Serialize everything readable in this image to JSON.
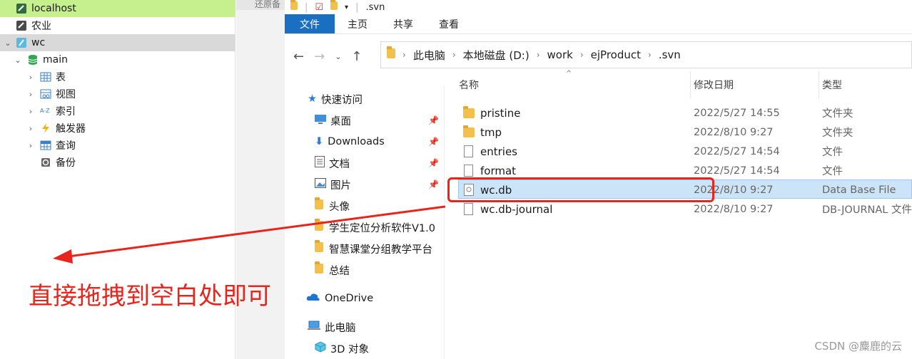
{
  "left_tree": {
    "items": [
      {
        "label": "localhost",
        "icon": "connection-icon"
      },
      {
        "label": "农业",
        "icon": "connection-icon"
      },
      {
        "label": "wc",
        "icon": "sqlite-connection-icon"
      },
      {
        "label": "main",
        "icon": "database-icon"
      },
      {
        "label": "表",
        "icon": "table-icon"
      },
      {
        "label": "视图",
        "icon": "view-icon"
      },
      {
        "label": "索引",
        "icon": "index-icon"
      },
      {
        "label": "触发器",
        "icon": "trigger-icon"
      },
      {
        "label": "查询",
        "icon": "query-icon"
      },
      {
        "label": "备份",
        "icon": "backup-icon"
      }
    ]
  },
  "middle_tab": {
    "label": "还原备"
  },
  "explorer": {
    "title": ".svn",
    "ribbon_tabs": [
      "文件",
      "主页",
      "共享",
      "查看"
    ],
    "breadcrumb": [
      "此电脑",
      "本地磁盘 (D:)",
      "work",
      "ejProduct",
      ".svn"
    ],
    "nav_items": [
      {
        "label": "快速访问",
        "icon": "star-icon"
      },
      {
        "label": "桌面",
        "icon": "desktop-icon"
      },
      {
        "label": "Downloads",
        "icon": "download-icon"
      },
      {
        "label": "文档",
        "icon": "document-icon"
      },
      {
        "label": "图片",
        "icon": "pictures-icon"
      },
      {
        "label": "头像",
        "icon": "folder-icon"
      },
      {
        "label": "学生定位分析软件V1.0",
        "icon": "folder-icon"
      },
      {
        "label": "智慧课堂分组教学平台",
        "icon": "folder-icon"
      },
      {
        "label": "总结",
        "icon": "folder-icon"
      },
      {
        "label": "OneDrive",
        "icon": "cloud-icon"
      },
      {
        "label": "此电脑",
        "icon": "computer-icon"
      },
      {
        "label": "3D 对象",
        "icon": "cube-icon"
      }
    ],
    "columns": {
      "name": "名称",
      "date": "修改日期",
      "type": "类型"
    },
    "files": [
      {
        "name": "pristine",
        "date": "2022/5/27 14:55",
        "type": "文件夹",
        "icon": "folder-icon"
      },
      {
        "name": "tmp",
        "date": "2022/8/10 9:27",
        "type": "文件夹",
        "icon": "folder-icon"
      },
      {
        "name": "entries",
        "date": "2022/5/27 14:54",
        "type": "文件",
        "icon": "file-icon"
      },
      {
        "name": "format",
        "date": "2022/5/27 14:54",
        "type": "文件",
        "icon": "file-icon"
      },
      {
        "name": "wc.db",
        "date": "2022/8/10 9:27",
        "type": "Data Base File",
        "icon": "db-file-icon",
        "selected": true
      },
      {
        "name": "wc.db-journal",
        "date": "2022/8/10 9:27",
        "type": "DB-JOURNAL 文件",
        "icon": "file-icon"
      }
    ]
  },
  "annotation": {
    "text": "直接拖拽到空白处即可",
    "color": "#e8241b"
  },
  "watermark": "CSDN @麋鹿的云",
  "colors": {
    "accent": "#1a6fc0",
    "selection": "#cce4f7",
    "tree_highlight_top": "#c6f08e",
    "tree_highlight_wc": "#d9d9d9",
    "annotation": "#e8241b"
  }
}
